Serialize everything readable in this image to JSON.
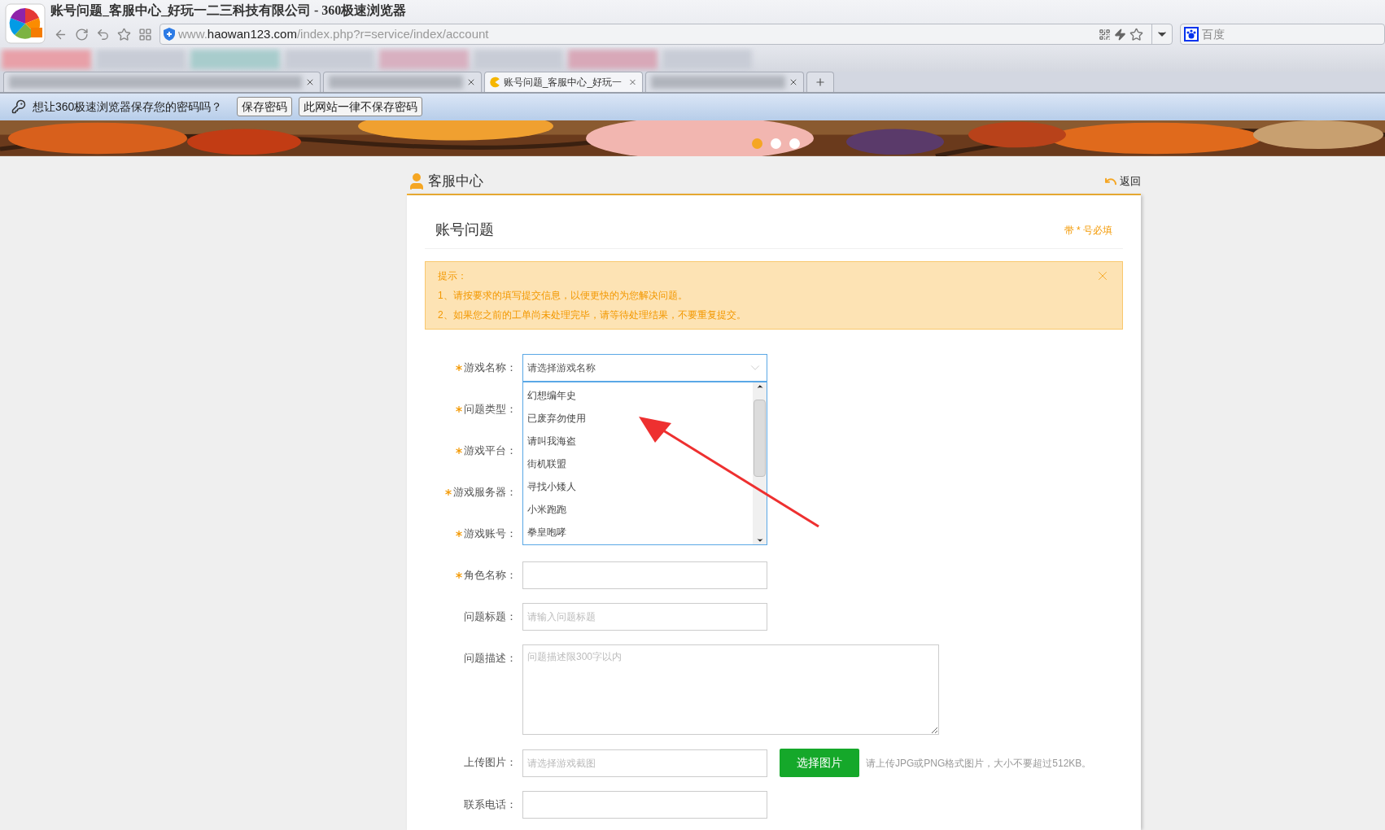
{
  "browser": {
    "title": "账号问题_客服中心_好玩一二三科技有限公司 - 360极速浏览器",
    "url_domain": "haowan123.com",
    "url_path": "/index.php?r=service/index/account",
    "url_prefix": "www.",
    "search_engine": "百度",
    "tabs": [
      {
        "kind": "blurred",
        "selected": false
      },
      {
        "kind": "blurred",
        "selected": false
      },
      {
        "kind": "page",
        "label": "账号问题_客服中心_好玩一",
        "selected": true
      },
      {
        "kind": "blurred",
        "selected": false
      }
    ]
  },
  "password_bar": {
    "prompt": "想让360极速浏览器保存您的密码吗？",
    "buttons": [
      "保存密码",
      "此网站一律不保存密码"
    ]
  },
  "banner": {
    "slides": [
      {
        "selected": true
      },
      {
        "selected": false
      },
      {
        "selected": false
      }
    ]
  },
  "page": {
    "header": "客服中心",
    "back": "返回",
    "section_title": "账号问题",
    "required_note": "带 * 号必填",
    "tip": {
      "title": "提示：",
      "lines": [
        "1、请按要求的填写提交信息，以便更快的为您解决问题。",
        "2、如果您之前的工单尚未处理完毕，请等待处理结果，不要重复提交。"
      ]
    },
    "fields": [
      {
        "label": "游戏名称：",
        "required": true,
        "kind": "select",
        "placeholder": "请选择游戏名称",
        "expanded": true,
        "options": [
          "幻想编年史",
          "已废弃勿使用",
          "请叫我海盗",
          "街机联盟",
          "寻找小矮人",
          "小米跑跑",
          "拳皇咆哮"
        ]
      },
      {
        "label": "问题类型：",
        "required": true,
        "kind": "covered"
      },
      {
        "label": "游戏平台：",
        "required": true,
        "kind": "covered"
      },
      {
        "label": "游戏服务器：",
        "required": true,
        "kind": "covered"
      },
      {
        "label": "游戏账号：",
        "required": true,
        "kind": "covered"
      },
      {
        "label": "角色名称：",
        "required": true,
        "kind": "text"
      },
      {
        "label": "问题标题：",
        "required": false,
        "kind": "text",
        "placeholder": "请输入问题标题"
      },
      {
        "label": "问题描述：",
        "required": false,
        "kind": "textarea",
        "placeholder": "问题描述限300字以内"
      },
      {
        "label": "上传图片：",
        "required": false,
        "kind": "file",
        "placeholder": "请选择游戏截图",
        "button": "选择图片",
        "hint": "请上传JPG或PNG格式图片，大小不要超过512KB。"
      },
      {
        "label": "联系电话：",
        "required": false,
        "kind": "text"
      }
    ]
  }
}
